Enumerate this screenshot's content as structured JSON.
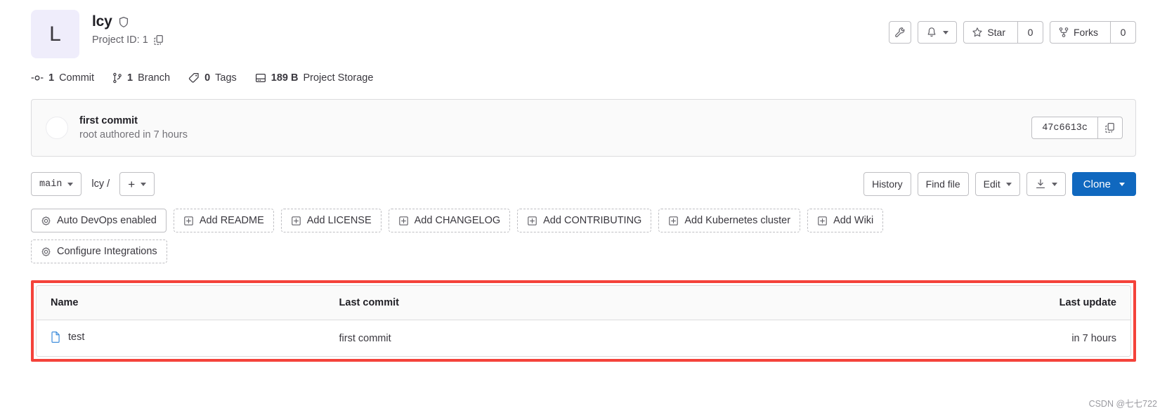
{
  "project": {
    "avatar_letter": "L",
    "name": "lcy",
    "visibility_icon": "shield-icon",
    "project_id_label": "Project ID: 1",
    "copy_icon": "copy-icon"
  },
  "header_actions": {
    "wrench_icon": "wrench-icon",
    "bell_icon": "bell-icon",
    "star_label": "Star",
    "star_count": "0",
    "forks_label": "Forks",
    "forks_count": "0"
  },
  "stats": [
    {
      "icon": "commit-icon",
      "value": "1",
      "label": "Commit"
    },
    {
      "icon": "branch-icon",
      "value": "1",
      "label": "Branch"
    },
    {
      "icon": "tag-icon",
      "value": "0",
      "label": "Tags"
    },
    {
      "icon": "storage-icon",
      "value": "189 B",
      "label": "Project Storage"
    }
  ],
  "last_commit": {
    "title": "first commit",
    "subtitle": "root authored in 7 hours",
    "sha": "47c6613c"
  },
  "ref_bar": {
    "branch": "main",
    "breadcrumb": "lcy /",
    "add_label": "+",
    "history_label": "History",
    "find_file_label": "Find file",
    "edit_label": "Edit",
    "download_icon": "download-icon",
    "clone_label": "Clone"
  },
  "quick_actions_row1": [
    {
      "label": "Auto DevOps enabled",
      "icon": "gear-icon",
      "style": "solid"
    },
    {
      "label": "Add README",
      "icon": "plus-square-icon",
      "style": "dashed"
    },
    {
      "label": "Add LICENSE",
      "icon": "plus-square-icon",
      "style": "dashed"
    },
    {
      "label": "Add CHANGELOG",
      "icon": "plus-square-icon",
      "style": "dashed"
    },
    {
      "label": "Add CONTRIBUTING",
      "icon": "plus-square-icon",
      "style": "dashed"
    },
    {
      "label": "Add Kubernetes cluster",
      "icon": "plus-square-icon",
      "style": "dashed"
    },
    {
      "label": "Add Wiki",
      "icon": "plus-square-icon",
      "style": "dashed"
    }
  ],
  "quick_actions_row2": [
    {
      "label": "Configure Integrations",
      "icon": "gear-icon",
      "style": "dashed"
    }
  ],
  "file_table": {
    "columns": [
      "Name",
      "Last commit",
      "Last update"
    ],
    "rows": [
      {
        "name": "test",
        "icon": "file-icon",
        "last_commit": "first commit",
        "last_update": "in 7 hours"
      }
    ],
    "highlight_color": "#f4423a"
  },
  "watermark": "CSDN @七七722"
}
